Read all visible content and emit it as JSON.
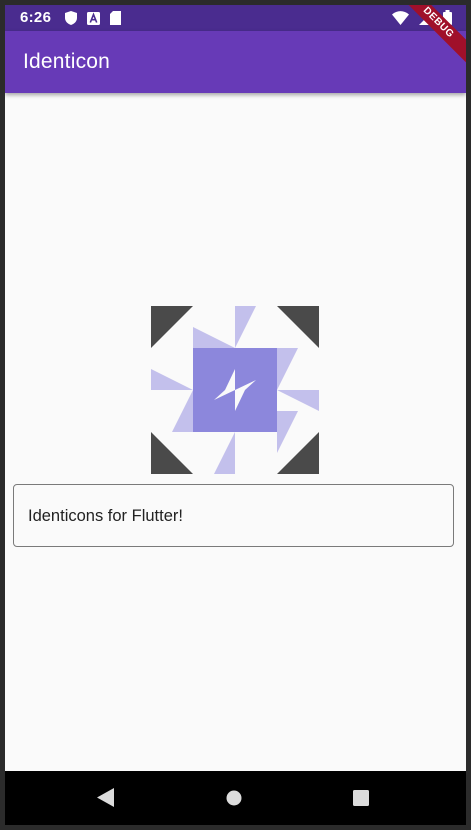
{
  "status_bar": {
    "time": "6:26",
    "left_icons": [
      "shield-icon",
      "a-notification-icon",
      "sd-card-icon"
    ],
    "right_icons": [
      "wifi-icon",
      "signal-icon",
      "battery-icon"
    ],
    "background": "#4a2c8f"
  },
  "app_bar": {
    "title": "Identicon",
    "background": "#673ab7"
  },
  "debug_banner": {
    "label": "DEBUG",
    "color": "#a0102a"
  },
  "identicon": {
    "icon": "identicon-image",
    "foreground_dark": "#4a4a4a",
    "foreground_accent": "#8c87dc",
    "foreground_light": "#c3c0ec"
  },
  "text_field": {
    "value": "Identicons for Flutter!"
  },
  "nav_bar": {
    "buttons": [
      "back-icon",
      "home-icon",
      "recents-icon"
    ]
  }
}
